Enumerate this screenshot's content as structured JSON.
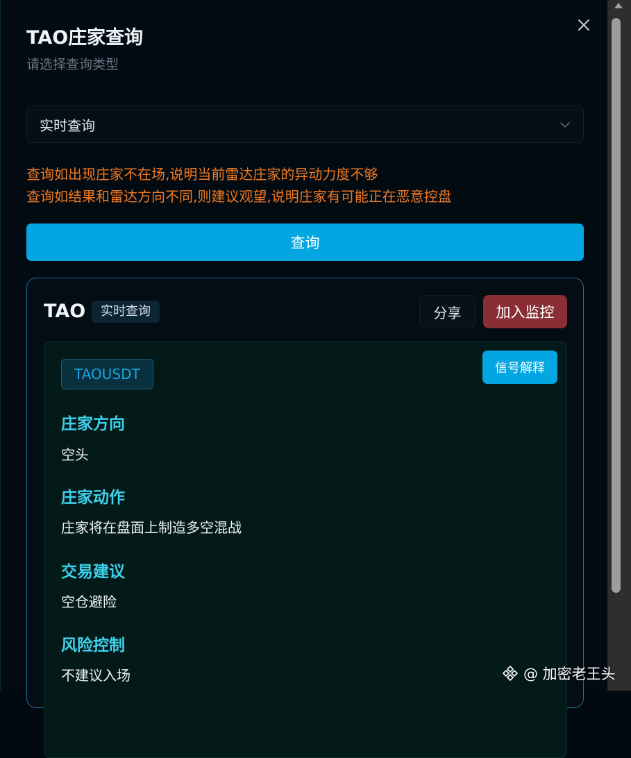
{
  "header": {
    "title": "TAO庄家查询",
    "subtitle": "请选择查询类型"
  },
  "select": {
    "value": "实时查询"
  },
  "warnings": [
    "查询如出现庄家不在场,说明当前雷达庄家的异动力度不够",
    "查询如结果和雷达方向不同,则建议观望,说明庄家有可能正在恶意控盘"
  ],
  "query_button": "查询",
  "result": {
    "coin": "TAO",
    "type_badge": "实时查询",
    "share_button": "分享",
    "monitor_button": "加入监控",
    "pair": "TAOUSDT",
    "explain_button": "信号解释",
    "sections": [
      {
        "title": "庄家方向",
        "value": "空头"
      },
      {
        "title": "庄家动作",
        "value": "庄家将在盘面上制造多空混战"
      },
      {
        "title": "交易建议",
        "value": "空仓避险"
      },
      {
        "title": "风险控制",
        "value": "不建议入场"
      }
    ]
  },
  "watermark": "@ 加密老王头",
  "colors": {
    "accent": "#03a6e0",
    "warning": "#f07a22",
    "section_title": "#3ed1ec",
    "monitor": "#8a2e35"
  }
}
